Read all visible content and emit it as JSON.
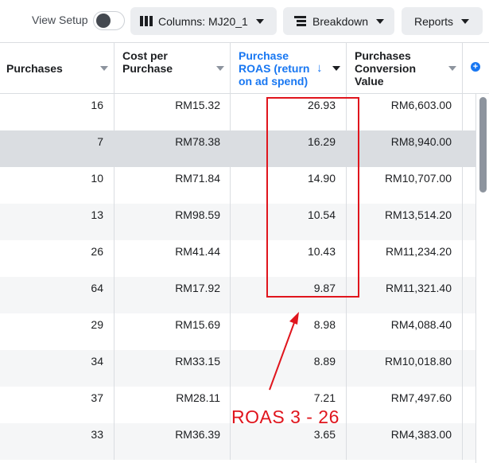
{
  "toolbar": {
    "view_setup_label": "View Setup",
    "columns_label": "Columns: MJ20_1",
    "breakdown_label": "Breakdown",
    "reports_label": "Reports",
    "view_setup_toggle_on": false
  },
  "table": {
    "headers": {
      "purchases": "Purchases",
      "cost_per_purchase_line1": "Cost per",
      "cost_per_purchase_line2": "Purchase",
      "roas_line1": "Purchase",
      "roas_line2": "ROAS (return",
      "roas_line3": "on ad spend)",
      "conv_value_line1": "Purchases",
      "conv_value_line2": "Conversion",
      "conv_value_line3": "Value"
    },
    "sorted_column": "roas",
    "sort_direction": "descending",
    "rows": [
      {
        "purchases": "16",
        "cost": "RM15.32",
        "roas": "26.93",
        "conv_value": "RM6,603.00"
      },
      {
        "purchases": "7",
        "cost": "RM78.38",
        "roas": "16.29",
        "conv_value": "RM8,940.00"
      },
      {
        "purchases": "10",
        "cost": "RM71.84",
        "roas": "14.90",
        "conv_value": "RM10,707.00"
      },
      {
        "purchases": "13",
        "cost": "RM98.59",
        "roas": "10.54",
        "conv_value": "RM13,514.20"
      },
      {
        "purchases": "26",
        "cost": "RM41.44",
        "roas": "10.43",
        "conv_value": "RM11,234.20"
      },
      {
        "purchases": "64",
        "cost": "RM17.92",
        "roas": "9.87",
        "conv_value": "RM11,321.40"
      },
      {
        "purchases": "29",
        "cost": "RM15.69",
        "roas": "8.98",
        "conv_value": "RM4,088.40"
      },
      {
        "purchases": "34",
        "cost": "RM33.15",
        "roas": "8.89",
        "conv_value": "RM10,018.80"
      },
      {
        "purchases": "37",
        "cost": "RM28.11",
        "roas": "7.21",
        "conv_value": "RM7,497.60"
      },
      {
        "purchases": "33",
        "cost": "RM36.39",
        "roas": "3.65",
        "conv_value": "RM4,383.00"
      }
    ]
  },
  "annotation": {
    "text": "ROAS 3 - 26",
    "color": "#e0151d"
  },
  "colors": {
    "accent": "#1877f2",
    "highlight_row": "#dadde1",
    "alt_row": "#f5f6f7"
  }
}
